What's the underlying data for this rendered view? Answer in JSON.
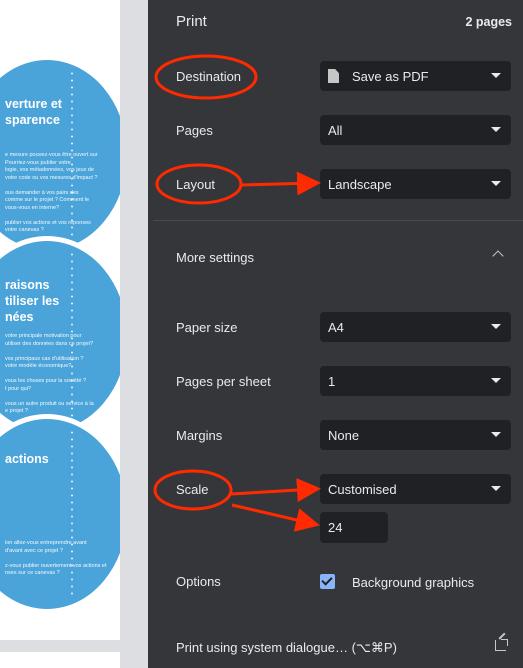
{
  "preview": {
    "circles": [
      {
        "title": "verture et\nsparence",
        "text": "e mesure pouvez-vous être ouvert sur\nPourriez-vous publier votre\nlogie, vos métadonnées, vos jeux de\nvotre code ou vos mesures d'impact ?\n\nous demander à vos pairs des\ncomme sur le projet ? Comment le\nvous-vous en interne?\n\npublier vos actions et vos réponses\nvotre canevas ?"
      },
      {
        "title": "raisons\ntiliser les\nnées",
        "text": "votre principale motivation pour\nutiliser des données dans ce projet?\n\nvos principaux cas d'utilisation ?\nvotre modèle économique?\n\nvous les choses pour la société ?\nt pour qui?\n\nvous un autre produit ou service à la\ne projet ?"
      },
      {
        "title": "actions",
        "text": "ion allez-vous entreprendre avant\nd'avant avec ce projet ?\n\nz-vous publier ouvertement vos actions et\nnses sur ce canevas ?"
      }
    ]
  },
  "header": {
    "title": "Print",
    "page_count": "2 pages"
  },
  "settings": {
    "destination": {
      "label": "Destination",
      "value": "Save as PDF",
      "icon": "file-icon"
    },
    "pages": {
      "label": "Pages",
      "value": "All"
    },
    "layout": {
      "label": "Layout",
      "value": "Landscape"
    },
    "more_settings": {
      "label": "More settings"
    },
    "paper_size": {
      "label": "Paper size",
      "value": "A4"
    },
    "pages_per_sheet": {
      "label": "Pages per sheet",
      "value": "1"
    },
    "margins": {
      "label": "Margins",
      "value": "None"
    },
    "scale": {
      "label": "Scale",
      "value": "Customised",
      "custom_value": "24"
    },
    "options": {
      "label": "Options",
      "background_graphics": "Background graphics",
      "background_graphics_checked": true
    },
    "system_dialog": {
      "label": "Print using system dialogue… (⌥⌘P)",
      "icon": "open-external-icon"
    }
  },
  "annotations": {
    "color": "#ff2a00"
  }
}
